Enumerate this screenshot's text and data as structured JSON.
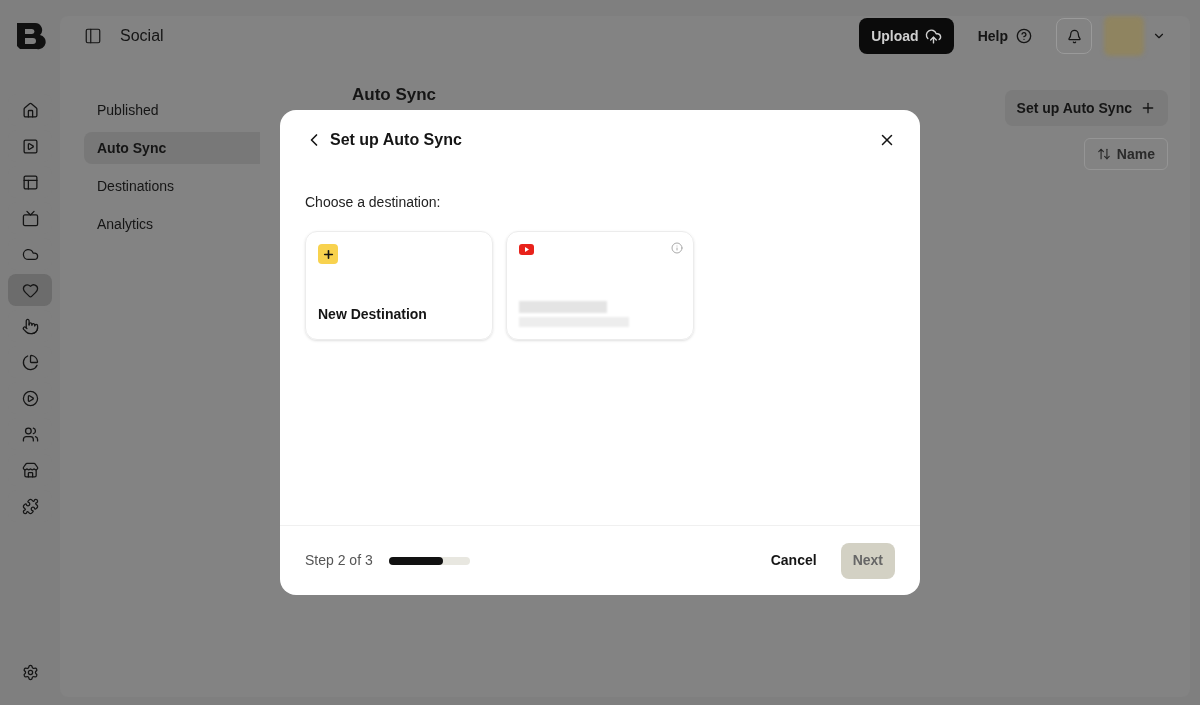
{
  "header": {
    "title": "Social",
    "upload_label": "Upload",
    "help_label": "Help"
  },
  "rail": {
    "items": [
      {
        "selected": false
      },
      {
        "selected": false
      },
      {
        "selected": false
      },
      {
        "selected": false
      },
      {
        "selected": false
      },
      {
        "selected": true
      },
      {
        "selected": false
      },
      {
        "selected": false
      },
      {
        "selected": false
      },
      {
        "selected": false
      },
      {
        "selected": false
      },
      {
        "selected": false
      }
    ]
  },
  "subnav": [
    {
      "label": "Published",
      "selected": false
    },
    {
      "label": "Auto Sync",
      "selected": true
    },
    {
      "label": "Destinations",
      "selected": false
    },
    {
      "label": "Analytics",
      "selected": false
    }
  ],
  "page": {
    "heading": "Auto Sync",
    "setup_button": "Set up Auto Sync",
    "sort_button": "Name"
  },
  "modal": {
    "title": "Set up Auto Sync",
    "prompt": "Choose a destination:",
    "cards": [
      {
        "kind": "new",
        "label": "New Destination"
      },
      {
        "kind": "channel"
      }
    ],
    "step": "Step 2 of 3",
    "progress": {
      "level": 0.67
    },
    "cancel": "Cancel",
    "next": {
      "label": "Next",
      "disabled": true
    }
  }
}
